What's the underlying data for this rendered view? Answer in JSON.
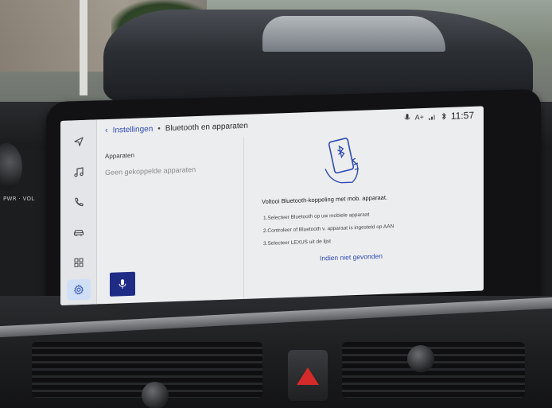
{
  "header": {
    "back_icon": "chevron-left-icon",
    "parent_label": "Instellingen",
    "separator": "•",
    "title": "Bluetooth en apparaten"
  },
  "status_bar": {
    "icons": [
      "mic-status-icon",
      "text-size-icon",
      "signal-icon",
      "bluetooth-icon"
    ],
    "text_size_label": "A+",
    "time": "11:57"
  },
  "rail": {
    "items": [
      {
        "icon": "navigation-icon"
      },
      {
        "icon": "music-icon"
      },
      {
        "icon": "phone-icon"
      },
      {
        "icon": "car-icon"
      },
      {
        "icon": "apps-grid-icon"
      },
      {
        "icon": "settings-gear-icon",
        "active": true
      }
    ]
  },
  "devices": {
    "section_label": "Apparaten",
    "empty_text": "Geen gekoppelde apparaten"
  },
  "voice_button": {
    "icon": "microphone-icon"
  },
  "pairing": {
    "illustration": "phone-bluetooth-hand-icon",
    "title": "Voltooi Bluetooth-koppeling met mob. apparaat.",
    "steps": [
      "1.Selecteer Bluetooth op uw mobiele apparaat",
      "2.Controleer of Bluetooth v. apparaat is ingesteld op AAN",
      "3.Selecteer LEXUS uit de lijst"
    ],
    "link_label": "Indien niet gevonden"
  },
  "hardware": {
    "power_volume_label": "PWR · VOL"
  },
  "colors": {
    "accent": "#2f4bb3",
    "voice_button_bg": "#1f2c86",
    "screen_bg": "#ecedef",
    "hazard": "#d42a2a"
  }
}
